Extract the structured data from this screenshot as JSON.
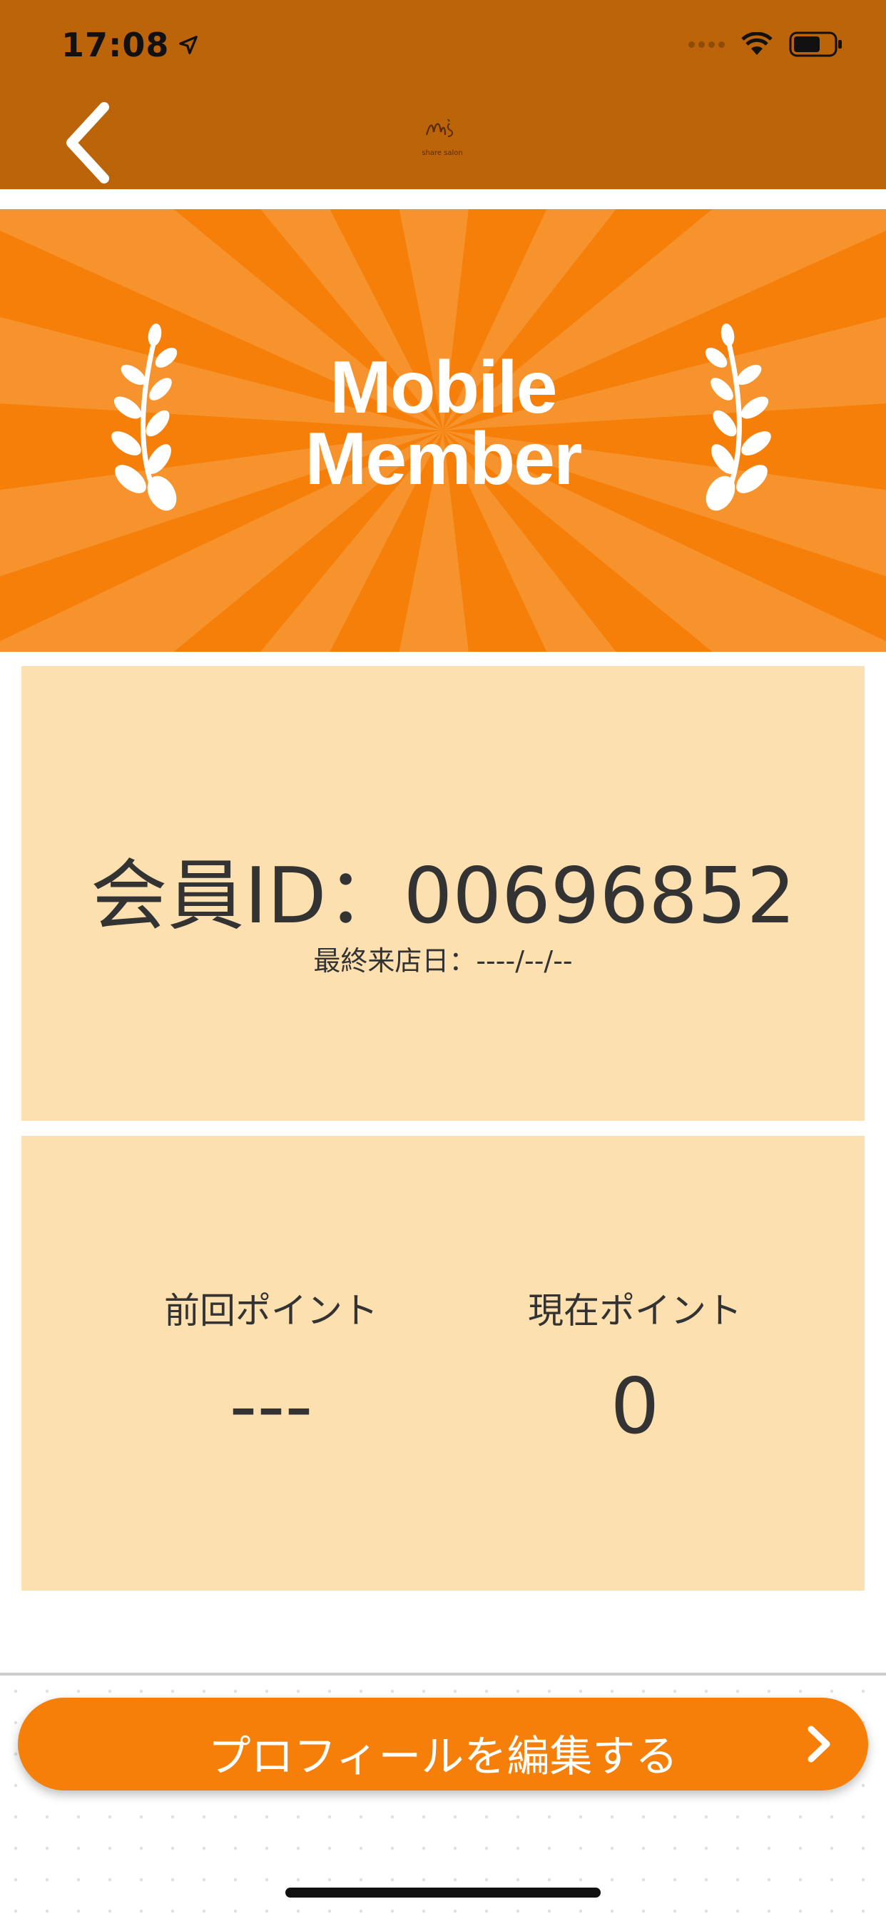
{
  "status_bar": {
    "time": "17:08"
  },
  "header": {
    "logo_text": "M's",
    "logo_subtext": "share salon"
  },
  "banner": {
    "title_line1": "Mobile",
    "title_line2": "Member"
  },
  "member_card": {
    "id_text": "会員ID：00696852",
    "last_visit": "最終来店日：----/--/--"
  },
  "points_card": {
    "previous_label": "前回ポイント",
    "previous_value": "---",
    "current_label": "現在ポイント",
    "current_value": "0"
  },
  "edit_button": {
    "label": "プロフィールを編集する"
  },
  "colors": {
    "header": "#bb640a",
    "accent": "#f57f08",
    "card": "#fde0b0"
  }
}
